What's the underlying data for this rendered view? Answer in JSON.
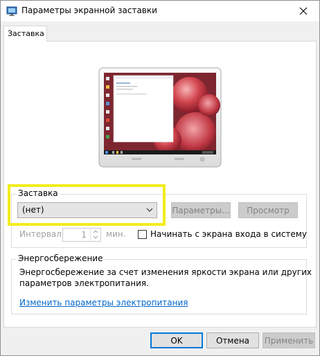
{
  "window": {
    "title": "Параметры экранной заставки",
    "close_icon": "close-icon"
  },
  "tabs": [
    {
      "label": "Заставка",
      "selected": true
    }
  ],
  "screensaver": {
    "group_title": "Заставка",
    "selected": "(нет)",
    "settings_button": "Параметры...",
    "preview_button": "Просмотр",
    "interval_label": "Интервал:",
    "interval_value": "1",
    "interval_unit": "мин.",
    "logon_checkbox_label": "Начинать с экрана входа в систему",
    "logon_checked": false
  },
  "power": {
    "group_title": "Энергосбережение",
    "description_line1": "Энергосбережение за счет изменения яркости экрана или других",
    "description_line2": "параметров электропитания.",
    "link": "Изменить параметры электропитания"
  },
  "buttons": {
    "ok": "OK",
    "cancel": "Отмена",
    "apply": "Применить"
  },
  "colors": {
    "highlight": "#f2ec1c",
    "link": "#0066cc",
    "default_button_border": "#0078d7"
  }
}
